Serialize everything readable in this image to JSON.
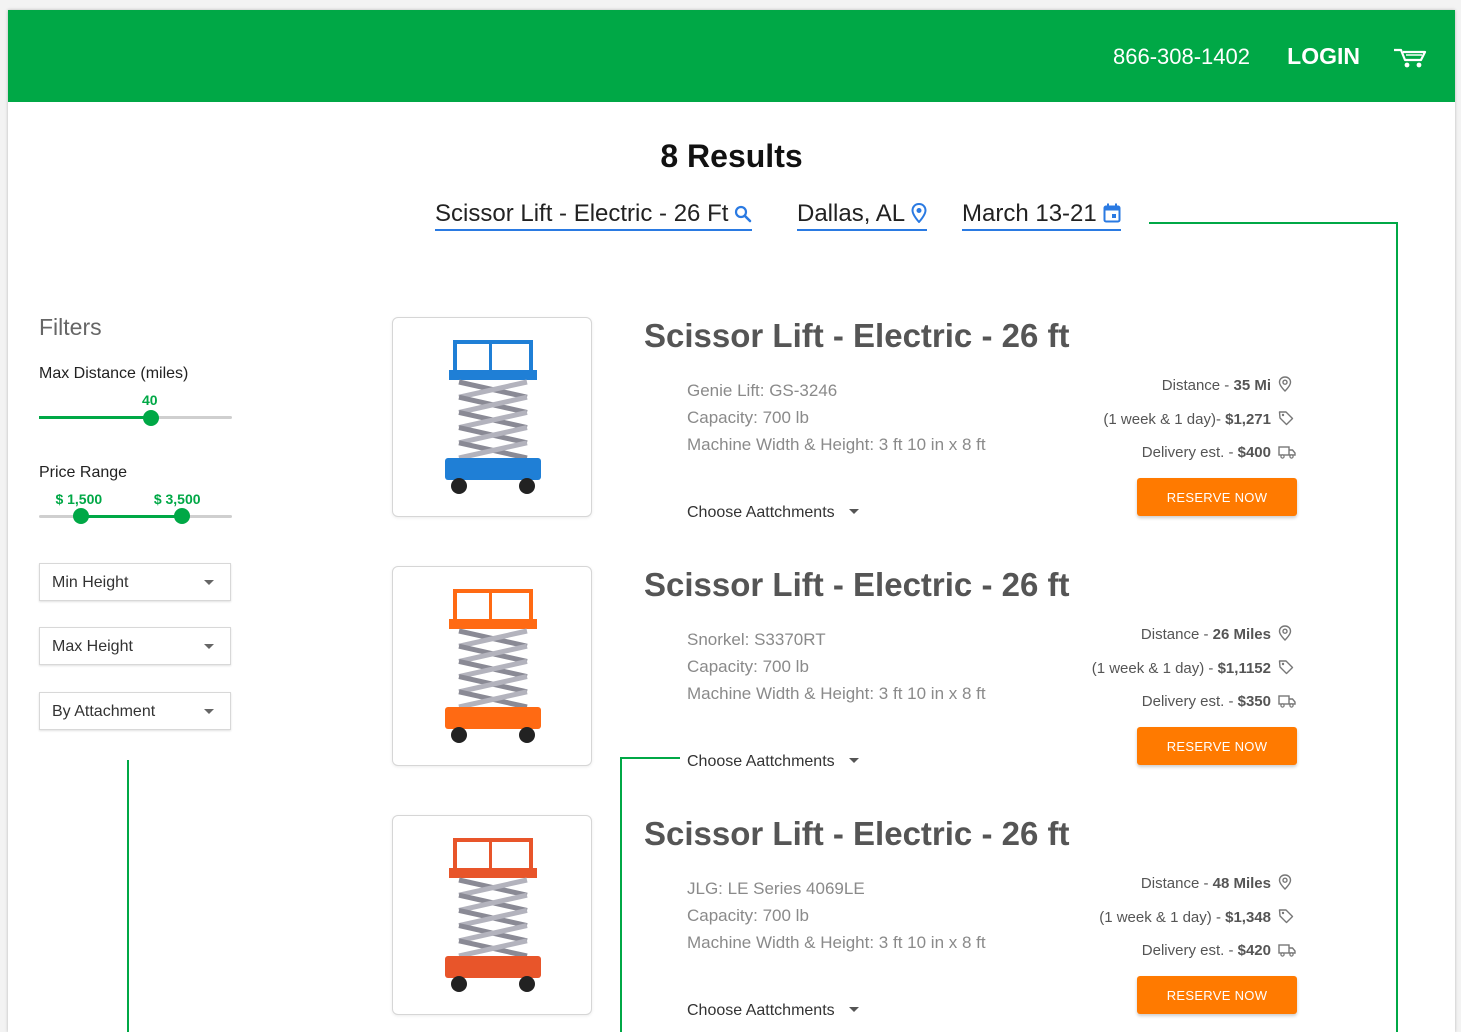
{
  "header": {
    "phone": "866-308-1402",
    "login_label": "LOGIN",
    "cart_icon": "cart-icon"
  },
  "results": {
    "title": "8 Results"
  },
  "search": {
    "equipment": "Scissor Lift - Electric - 26 Ft",
    "location": "Dallas, AL",
    "dates": "March 13-21"
  },
  "filters": {
    "title": "Filters",
    "max_distance_label": "Max Distance (miles)",
    "max_distance_value": "40",
    "max_distance_fraction": 0.58,
    "price_range_label": "Price Range",
    "price_min": "$ 1,500",
    "price_max": "$ 3,500",
    "price_min_fraction": 0.22,
    "price_max_fraction": 0.74,
    "dropdowns": [
      "Min Height",
      "Max Height",
      "By Attachment"
    ]
  },
  "listings": [
    {
      "title": "Scissor Lift - Electric - 26 ft",
      "model": "Genie Lift: GS-3246",
      "capacity": "Capacity: 700 lb",
      "dimensions": "Machine Width & Height: 3 ft 10 in x 8 ft",
      "attachments_label": "Choose Aattchments",
      "distance_label": "Distance - ",
      "distance_value": "35 Mi",
      "duration_label": "(1 week & 1 day)- ",
      "price": "$1,271",
      "delivery_label": "Delivery est. - ",
      "delivery_price": "$400",
      "reserve_label": "RESERVE NOW",
      "color": "#1f7fd6"
    },
    {
      "title": "Scissor Lift - Electric - 26 ft",
      "model": "Snorkel: S3370RT",
      "capacity": "Capacity: 700 lb",
      "dimensions": "Machine Width & Height: 3 ft 10 in x 8 ft",
      "attachments_label": "Choose Aattchments",
      "distance_label": "Distance - ",
      "distance_value": "26 Miles",
      "duration_label": "(1 week & 1 day) - ",
      "price": "$1,1152",
      "delivery_label": "Delivery est. - ",
      "delivery_price": "$350",
      "reserve_label": "RESERVE NOW",
      "color": "#ff6a13"
    },
    {
      "title": "Scissor Lift - Electric - 26 ft",
      "model": "JLG: LE Series 4069LE",
      "capacity": "Capacity: 700 lb",
      "dimensions": "Machine Width & Height: 3 ft 10 in x 8 ft",
      "attachments_label": "Choose Aattchments",
      "distance_label": "Distance - ",
      "distance_value": "48 Miles",
      "duration_label": "(1 week & 1 day) - ",
      "price": "$1,348",
      "delivery_label": "Delivery est. - ",
      "delivery_price": "$420",
      "reserve_label": "RESERVE NOW",
      "color": "#e8552a"
    }
  ],
  "colors": {
    "brand_green": "#00a846",
    "reserve_orange": "#ff7a00",
    "search_underline": "#2a7ae2"
  }
}
